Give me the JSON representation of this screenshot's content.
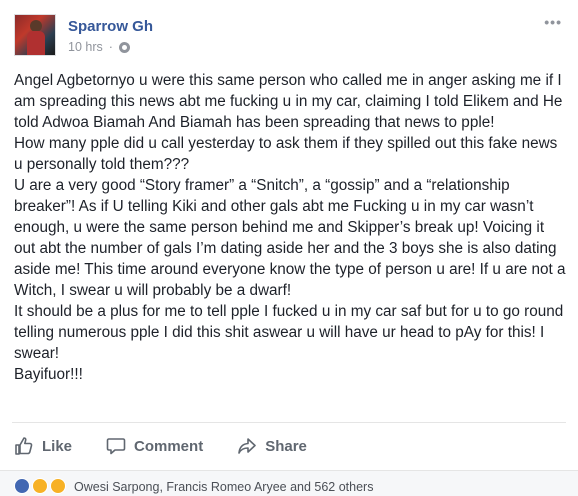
{
  "post": {
    "author": "Sparrow Gh",
    "time": "10 hrs",
    "separator": "·",
    "paragraphs": [
      "Angel Agbetornyo u were this same person who called me in anger asking me if I am spreading this news abt me fucking u in my car, claiming I told Elikem and He told Adwoa Biamah And Biamah has been spreading that news to pple!",
      "How many pple did u call yesterday to ask them if they spilled out this fake news u personally told them???",
      "U are a very good “Story framer” a “Snitch”, a “gossip” and a “relationship breaker”! As if U telling Kiki and other gals abt me Fucking u in my car wasn’t enough, u were the same person behind me and Skipper’s break up! Voicing it out abt the number of gals I’m dating aside her and the 3 boys she is also dating aside me! This time around everyone know the type of person u are! If u are not a Witch, I swear u will probably be a dwarf!",
      "It should be a plus for me to tell pple I fucked u in my car saf but for u to go round telling numerous pple I did this shit aswear u will have ur head to pAy for this! I swear!",
      "Bayifuor!!!"
    ]
  },
  "actions": {
    "like": "Like",
    "comment": "Comment",
    "share": "Share"
  },
  "reactions": {
    "summary": "Owesi Sarpong, Francis Romeo Aryee and 562 others"
  },
  "icons": [
    "globe-icon",
    "more-options-icon",
    "like-icon",
    "comment-icon",
    "share-icon",
    "like-reaction-icon",
    "haha-reaction-icon",
    "wow-reaction-icon"
  ],
  "colors": {
    "author": "#365899",
    "meta": "#90949c",
    "text": "#1d2129",
    "action": "#606770"
  }
}
